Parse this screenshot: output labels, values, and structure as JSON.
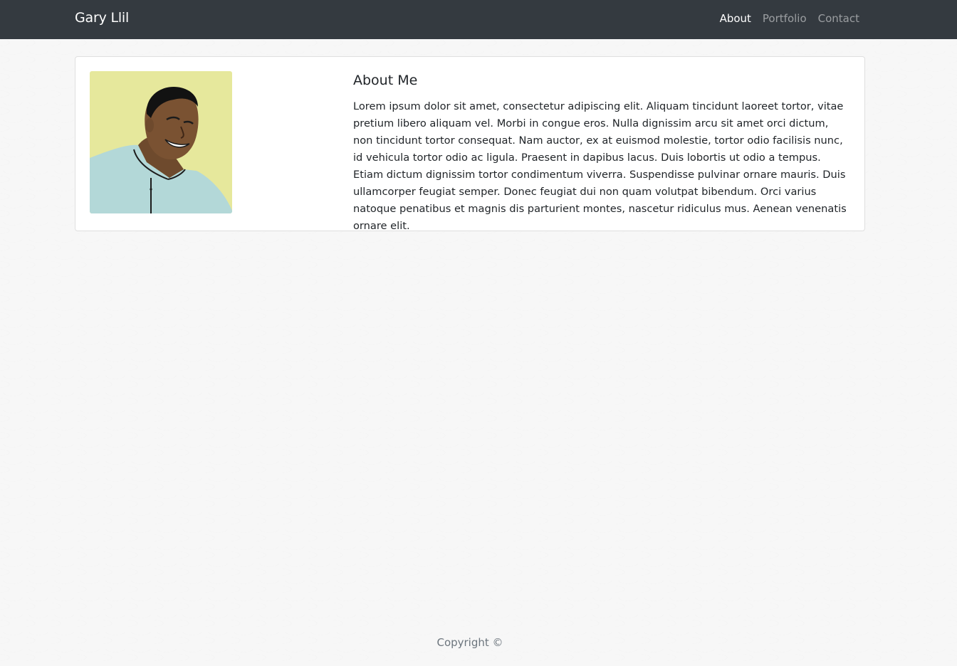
{
  "navbar": {
    "brand": "Gary Llil",
    "links": [
      {
        "label": "About",
        "active": true
      },
      {
        "label": "Portfolio",
        "active": false
      },
      {
        "label": "Contact",
        "active": false
      }
    ]
  },
  "about": {
    "title": "About Me",
    "text": "Lorem ipsum dolor sit amet, consectetur adipiscing elit. Aliquam tincidunt laoreet tortor, vitae pretium libero aliquam vel. Morbi in congue eros. Nulla dignissim arcu sit amet orci dictum, non tincidunt tortor consequat. Nam auctor, ex at euismod molestie, tortor odio facilisis nunc, id vehicula tortor odio ac ligula. Praesent in dapibus lacus. Duis lobortis ut odio a tempus. Etiam dictum dignissim tortor condimentum viverra. Suspendisse pulvinar ornare mauris. Duis ullamcorper feugiat semper. Donec feugiat dui non quam volutpat bibendum. Orci varius natoque penatibus et magnis dis parturient montes, nascetur ridiculus mus. Aenean venenatis ornare elit."
  },
  "footer": {
    "copyright": "Copyright ©"
  },
  "colors": {
    "navbar_bg": "#343a40",
    "avatar_bg": "#e6e89c",
    "shirt": "#b3d8d8",
    "skin": "#7a5232"
  },
  "icons": {
    "avatar": "person-illustration"
  }
}
